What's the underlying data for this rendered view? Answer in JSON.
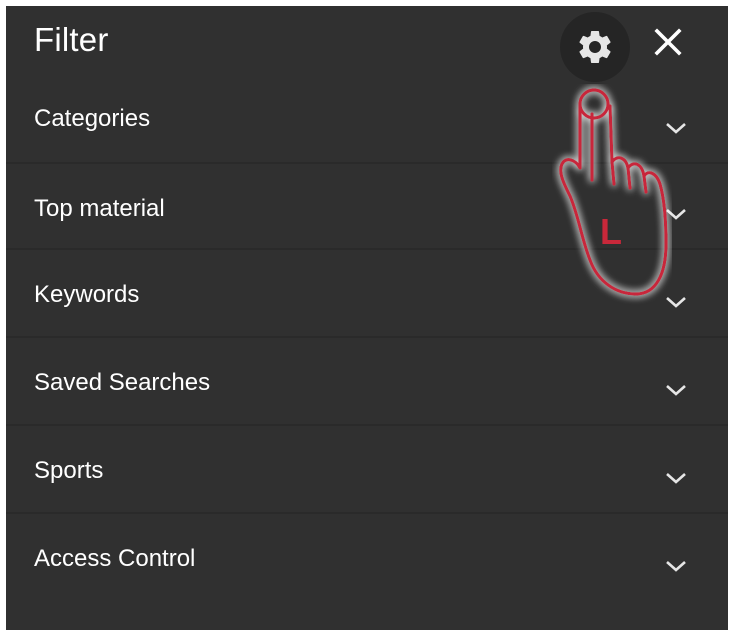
{
  "filter": {
    "title": "Filter",
    "settings_icon": "gear-icon",
    "close_icon": "close-icon",
    "sections": [
      {
        "label": "Categories",
        "icon": "chevron-down-icon"
      },
      {
        "label": "Top material",
        "icon": "chevron-down-icon"
      },
      {
        "label": "Keywords",
        "icon": "chevron-down-icon"
      },
      {
        "label": "Saved Searches",
        "icon": "chevron-down-icon"
      },
      {
        "label": "Sports",
        "icon": "chevron-down-icon"
      },
      {
        "label": "Access Control",
        "icon": "chevron-down-icon"
      }
    ]
  },
  "gesture": {
    "icon": "pointing-hand-icon",
    "label": "L",
    "color": "#c8283a"
  },
  "colors": {
    "panel_bg": "#303030",
    "text": "#ffffff",
    "icon": "#e6e6e6"
  }
}
